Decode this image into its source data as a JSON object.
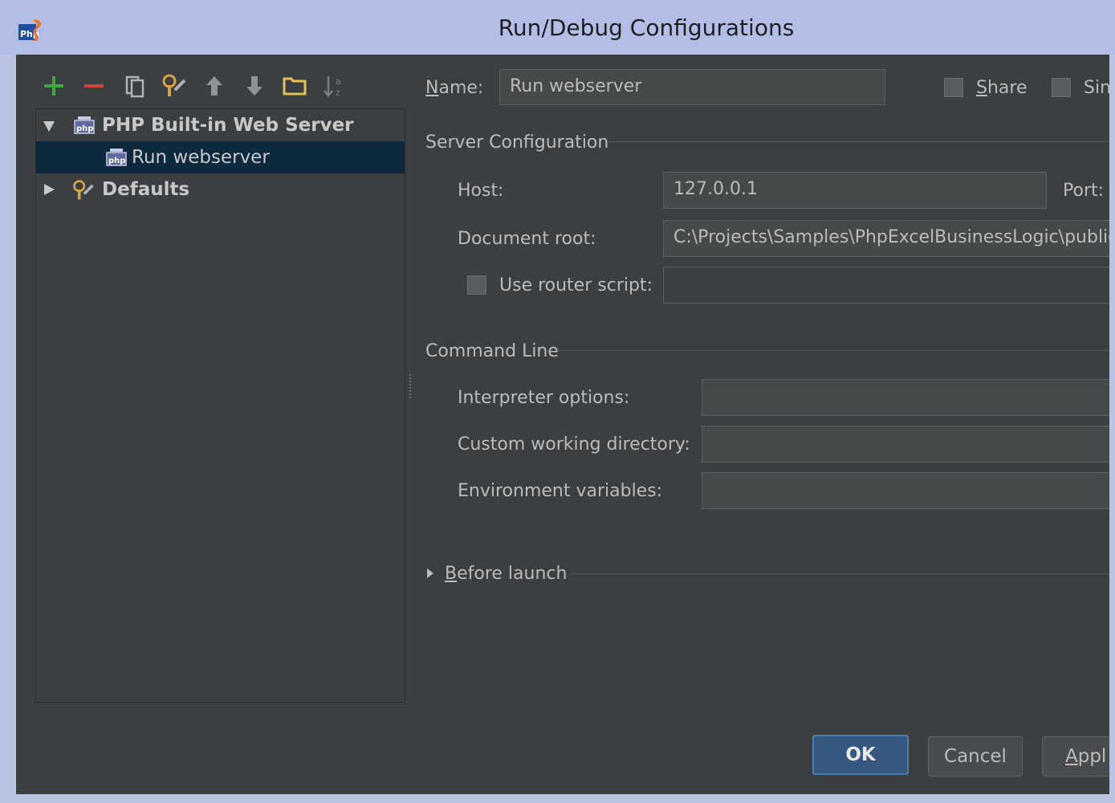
{
  "window": {
    "title": "Run/Debug Configurations"
  },
  "toolbar": {
    "icons": [
      "add-icon",
      "remove-icon",
      "copy-icon",
      "edit-defaults-icon",
      "move-up-icon",
      "move-down-icon",
      "folder-icon",
      "sort-icon"
    ]
  },
  "tree": {
    "group_label": "PHP Built-in Web Server",
    "item_label": "Run webserver",
    "defaults_label": "Defaults"
  },
  "form": {
    "name_label": "Name:",
    "name_value": "Run webserver",
    "share_label": "Share",
    "single_label": "Sin",
    "server_section": "Server Configuration",
    "host_label": "Host:",
    "host_value": "127.0.0.1",
    "port_label": "Port:",
    "docroot_label": "Document root:",
    "docroot_value": "C:\\Projects\\Samples\\PhpExcelBusinessLogic\\public",
    "router_label": "Use router script:",
    "router_value": "",
    "cmd_section": "Command Line",
    "interp_label": "Interpreter options:",
    "interp_value": "",
    "workdir_label": "Custom working directory:",
    "workdir_value": "",
    "env_label": "Environment variables:",
    "env_value": "",
    "before_launch": "Before launch"
  },
  "buttons": {
    "ok": "OK",
    "cancel": "Cancel",
    "apply": "Appl"
  },
  "colors": {
    "background": "#3c3f41",
    "selection": "#0d293e",
    "titlebar": "#b3bee6",
    "accent_green": "#3fa83b",
    "accent_red": "#d0433f"
  }
}
